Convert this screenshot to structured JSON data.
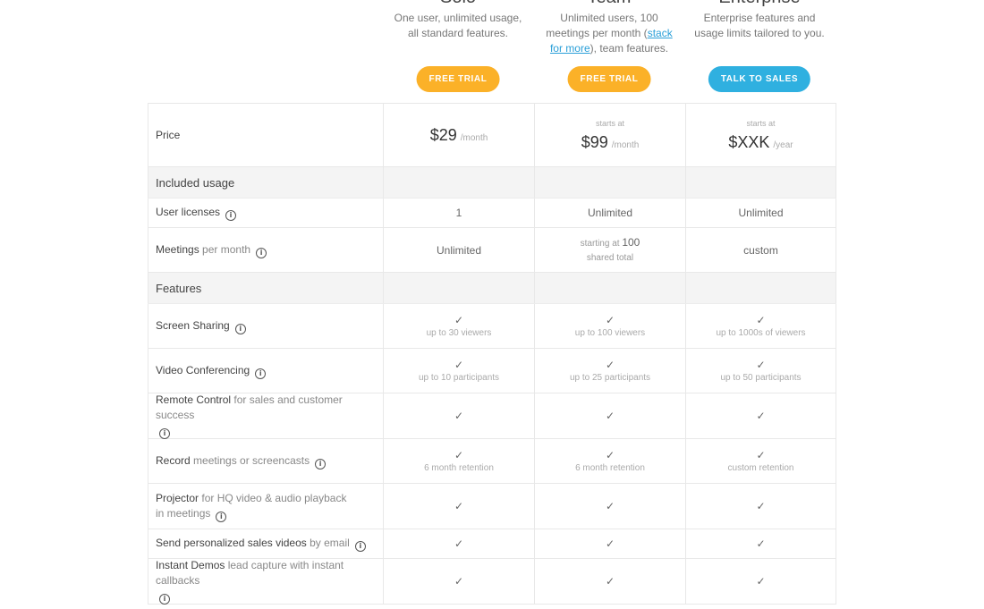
{
  "plans": [
    {
      "name": "Solo",
      "desc_parts": [
        "One user, unlimited usage, all standard features."
      ],
      "cta": "FREE TRIAL"
    },
    {
      "name": "Team",
      "desc_pre": "Unlimited users, 100 meetings per month (",
      "desc_link": "stack for more",
      "desc_post": "), team features.",
      "cta": "FREE TRIAL"
    },
    {
      "name": "Enterprise",
      "desc_parts": [
        "Enterprise features and usage limits tailored to you."
      ],
      "cta": "TALK TO SALES"
    }
  ],
  "price": {
    "label": "Price",
    "solo": {
      "amount": "$29",
      "unit": "/month"
    },
    "team": {
      "starts": "starts at",
      "amount": "$99",
      "unit": "/month"
    },
    "enterprise": {
      "starts": "starts at",
      "amount": "$XXK",
      "unit": "/year"
    }
  },
  "sections": {
    "usage": "Included usage",
    "features": "Features"
  },
  "rows": {
    "licenses": {
      "label": "User licenses",
      "solo": "1",
      "team": "Unlimited",
      "enterprise": "Unlimited"
    },
    "meetings": {
      "label": "Meetings",
      "sub": "per month",
      "solo": "Unlimited",
      "team_pre": "starting at",
      "team_num": "100",
      "team_post": "shared total",
      "enterprise": "custom"
    },
    "screen": {
      "label": "Screen Sharing",
      "solo": "up to 30 viewers",
      "team": "up to 100 viewers",
      "enterprise": "up to 1000s of viewers"
    },
    "video": {
      "label": "Video Conferencing",
      "solo": "up to 10 participants",
      "team": "up to 25 participants",
      "enterprise": "up to 50 participants"
    },
    "remote": {
      "label": "Remote Control",
      "sub": "for sales and customer success"
    },
    "record": {
      "label": "Record",
      "sub": "meetings or screencasts",
      "solo": "6 month retention",
      "team": "6 month retention",
      "enterprise": "custom retention"
    },
    "projector": {
      "label": "Projector",
      "sub": "for HQ video & audio playback in meetings"
    },
    "send": {
      "label": "Send personalized sales videos",
      "sub": "by email"
    },
    "demos": {
      "label": "Instant Demos",
      "sub": "lead capture with instant callbacks"
    }
  },
  "glyphs": {
    "check": "✓",
    "info": "i"
  }
}
